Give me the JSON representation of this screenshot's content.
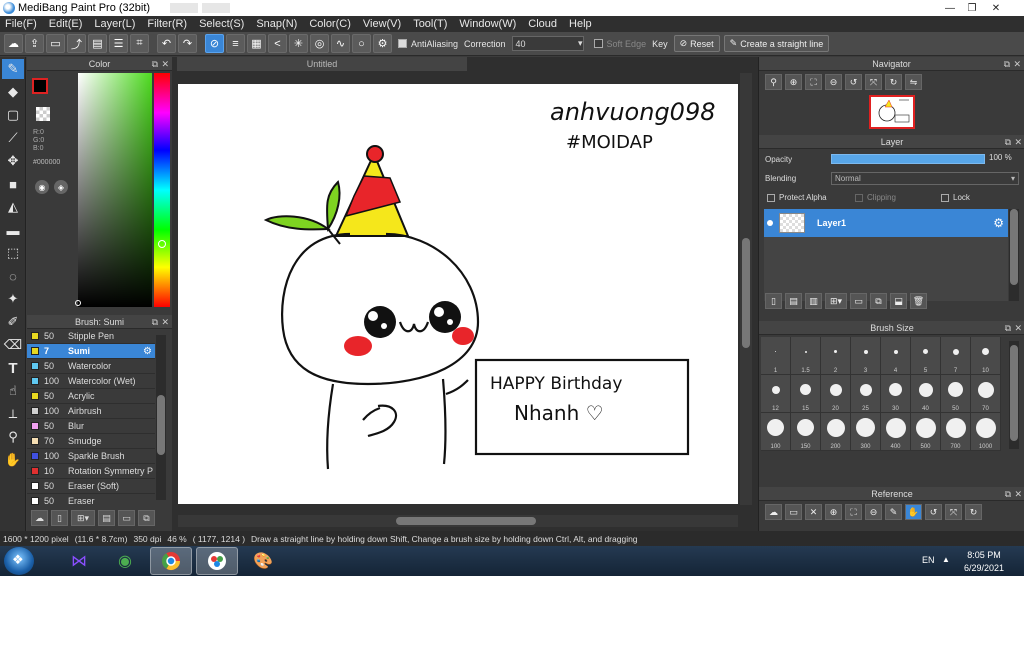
{
  "window": {
    "title": "MediBang Paint Pro (32bit)"
  },
  "menu": [
    "File(F)",
    "Edit(E)",
    "Layer(L)",
    "Filter(R)",
    "Select(S)",
    "Snap(N)",
    "Color(C)",
    "View(V)",
    "Tool(T)",
    "Window(W)",
    "Cloud",
    "Help"
  ],
  "toolbar": {
    "antialiasing_label": "AntiAliasing",
    "correction_label": "Correction",
    "correction_value": "40",
    "soft_edge_label": "Soft Edge",
    "key_label": "Key",
    "reset_label": "Reset",
    "straight_line_label": "Create a straight line"
  },
  "color_panel": {
    "title": "Color",
    "rgb_r": "R:0",
    "rgb_g": "G:0",
    "rgb_b": "B:0",
    "hex": "#000000",
    "foreground": "#000000",
    "hue_color": "#4ddb1f"
  },
  "brush_panel": {
    "title": "Brush: Sumi",
    "items": [
      {
        "size": "50",
        "name": "Stipple Pen",
        "color": "#e8d820"
      },
      {
        "size": "7",
        "name": "Sumi",
        "color": "#e8d820",
        "selected": true
      },
      {
        "size": "50",
        "name": "Watercolor",
        "color": "#5fc8f0"
      },
      {
        "size": "100",
        "name": "Watercolor (Wet)",
        "color": "#5fc8f0"
      },
      {
        "size": "50",
        "name": "Acrylic",
        "color": "#e8d820"
      },
      {
        "size": "100",
        "name": "Airbrush",
        "color": "#d0d0d0"
      },
      {
        "size": "50",
        "name": "Blur",
        "color": "#f0a0f0"
      },
      {
        "size": "70",
        "name": "Smudge",
        "color": "#f5deb3"
      },
      {
        "size": "100",
        "name": "Sparkle Brush",
        "color": "#4050e0"
      },
      {
        "size": "10",
        "name": "Rotation Symmetry P",
        "color": "#e03030"
      },
      {
        "size": "50",
        "name": "Eraser (Soft)",
        "color": "#ffffff"
      },
      {
        "size": "50",
        "name": "Eraser",
        "color": "#ffffff"
      }
    ]
  },
  "document": {
    "tab_title": "Untitled"
  },
  "artwork": {
    "signature_line1": "anhvuong098",
    "signature_line2": "#MOIDAP",
    "card_line1": "HAPPY Birthday",
    "card_line2": "Nhanh ♡"
  },
  "navigator": {
    "title": "Navigator"
  },
  "layer_panel": {
    "title": "Layer",
    "opacity_label": "Opacity",
    "opacity_value": "100 %",
    "opacity": 1.0,
    "blending_label": "Blending",
    "blending_value": "Normal",
    "protect_alpha_label": "Protect Alpha",
    "clipping_label": "Clipping",
    "lock_label": "Lock",
    "layer_name": "Layer1"
  },
  "brush_size_panel": {
    "title": "Brush Size",
    "sizes": [
      "1",
      "1.5",
      "2",
      "3",
      "4",
      "5",
      "7",
      "10",
      "12",
      "15",
      "20",
      "25",
      "30",
      "40",
      "50",
      "70",
      "100",
      "150",
      "200",
      "300",
      "400",
      "500",
      "700",
      "1000"
    ]
  },
  "reference_panel": {
    "title": "Reference"
  },
  "statusbar": {
    "dimensions": "1600 * 1200 pixel",
    "physical": "(11.6 * 8.7cm)",
    "dpi": "350 dpi",
    "zoom": "46 %",
    "coords": "( 1177, 1214 )",
    "hint": "Draw a straight line by holding down Shift, Change a brush size by holding down Ctrl, Alt, and dragging"
  },
  "taskbar": {
    "language": "EN",
    "time": "8:05 PM",
    "date": "6/29/2021"
  }
}
